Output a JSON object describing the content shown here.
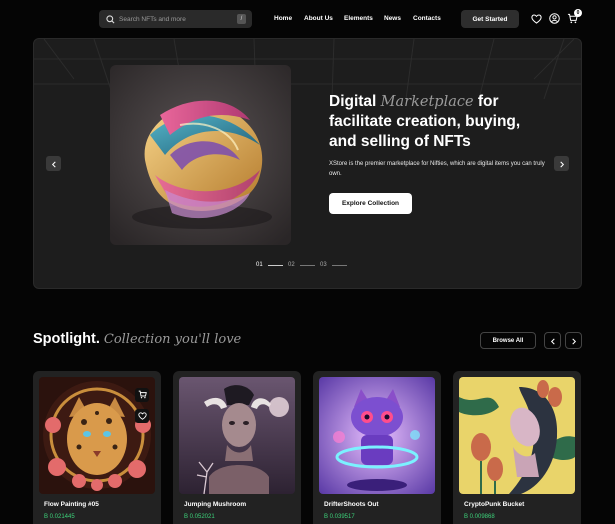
{
  "header": {
    "search_placeholder": "Search NFTs and more",
    "search_shortcut": "/",
    "nav": [
      "Home",
      "About Us",
      "Elements",
      "News",
      "Contacts"
    ],
    "cta": "Get Started",
    "icons": [
      "heart-icon",
      "user-icon",
      "cart-icon"
    ],
    "cart_count": "0"
  },
  "hero": {
    "title_1": "Digital ",
    "title_italic": "Marketplace",
    "title_2": " for facilitate creation, buying, and selling of NFTs",
    "description": "XStore is the premier marketplace for Nifties, which are digital items you can truly own.",
    "button": "Explore Collection",
    "pager": [
      "01",
      "02",
      "03"
    ]
  },
  "spotlight": {
    "title": "Spotlight.",
    "subtitle": "Collection you'll love",
    "browse": "Browse All",
    "cards": [
      {
        "name": "Flow Painting #05",
        "price": "B 0.021445"
      },
      {
        "name": "Jumping Mushroom",
        "price": "B 0.052021"
      },
      {
        "name": "DrifterShoots Out",
        "price": "B 0.039517"
      },
      {
        "name": "CryptoPunk Bucket",
        "price": "B 0.009868"
      }
    ]
  },
  "colors": {
    "accent_price": "#3cd27a",
    "background": "#050505",
    "panel": "#1d1d1d"
  }
}
